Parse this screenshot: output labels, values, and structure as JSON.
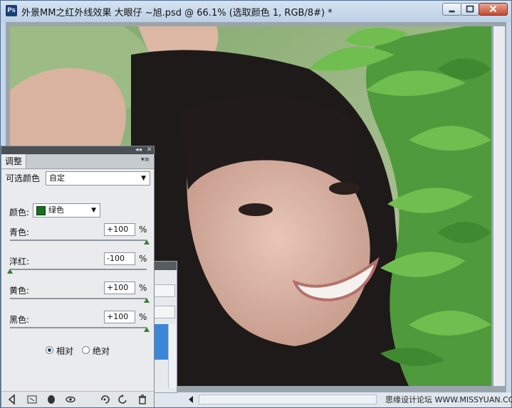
{
  "window": {
    "title": "外景MM之红外线效果 大眼仔 ~旭.psd @ 66.1% (选取颜色 1, RGB/8#) *",
    "app_icon": "Ps"
  },
  "adjustments_panel": {
    "tab_label": "调整",
    "preset_label": "可选颜色",
    "preset_value": "自定",
    "color_label": "颜色:",
    "color_value": "绿色",
    "color_swatch": "#1b6e1f",
    "sliders": [
      {
        "label": "青色:",
        "value": "+100",
        "unit": "%",
        "level": 1.0
      },
      {
        "label": "洋红:",
        "value": "-100",
        "unit": "%",
        "level": 0.0
      },
      {
        "label": "黄色:",
        "value": "+100",
        "unit": "%",
        "level": 1.0
      },
      {
        "label": "黑色:",
        "value": "+100",
        "unit": "%",
        "level": 1.0
      }
    ],
    "method_relative": "相对",
    "method_absolute": "绝对",
    "method_selected": "相对"
  },
  "statusbar": {
    "watermark": "思缘设计论坛 WWW.MISSYUAN.COM"
  }
}
